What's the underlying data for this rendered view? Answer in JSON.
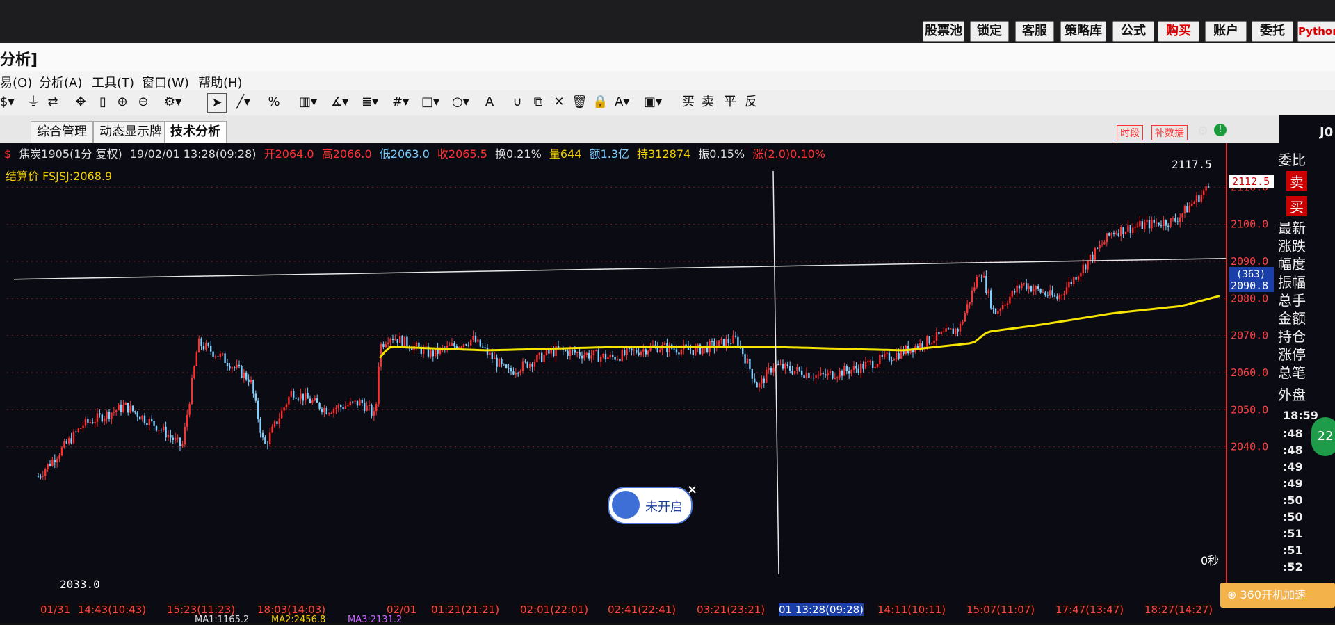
{
  "topbar": {
    "buttons": [
      "股票池",
      "锁定",
      "客服",
      "策略库",
      "公式",
      "购买",
      "账户",
      "委托",
      "Python"
    ]
  },
  "title": "分析]",
  "menu": [
    "易(O)",
    "分析(A)",
    "工具(T)",
    "窗口(W)",
    "帮助(H)"
  ],
  "toolbar": {
    "trade_labels": [
      "买",
      "卖",
      "平",
      "反"
    ],
    "text_tools": [
      "%",
      "A"
    ]
  },
  "tabs": [
    "综合管理",
    "动态显示牌",
    "技术分析"
  ],
  "chart_header": {
    "symbol": "焦炭1905(1分 复权)",
    "datetime": "19/02/01 13:28(09:28)",
    "open": "开2064.0",
    "high": "高2066.0",
    "low": "低2063.0",
    "close": "收2065.5",
    "turnover": "换0.21%",
    "volume": "量644",
    "amount": "额1.3亿",
    "hold": "持312874",
    "amplitude": "振0.15%",
    "change": "涨(2.0)0.10%",
    "settle": "结算价 FSJSJ:2068.9",
    "btn_time": "时段",
    "btn_fill": "补数据"
  },
  "chart_data": {
    "type": "candlestick",
    "ylim": [
      2030,
      2120
    ],
    "yticks": [
      "2110.0",
      "2100.0",
      "2090.0",
      "2080.0",
      "2070.0",
      "2060.0",
      "2050.0",
      "2040.0"
    ],
    "max_label": "2117.5",
    "min_label": "2033.0",
    "current_price": "2112.5",
    "cursor_price": "2090.8",
    "cursor_tag": "(363)",
    "seconds_label": "0秒",
    "x_labels": [
      "01/31",
      "14:43(10:43)",
      "15:23(11:23)",
      "18:03(14:03)",
      "02/01",
      "01:21(21:21)",
      "02:01(22:01)",
      "02:41(22:41)",
      "03:21(23:21)",
      "01 13:28(09:28)",
      "14:11(10:11)",
      "15:07(11:07)",
      "17:47(13:47)",
      "18:27(14:27)"
    ],
    "ma_labels": [
      "MA1:1165.2",
      "MA2:2456.8",
      "MA3:2131.2"
    ],
    "colors": {
      "up": "#ff3030",
      "down": "#80d0ff",
      "ma": "#f5e400",
      "grid": "#7a2020"
    }
  },
  "right_panel": {
    "labels": [
      "委比",
      "卖",
      "买",
      "最新",
      "涨跌",
      "幅度",
      "振幅",
      "总手",
      "金额",
      "持仓",
      "涨停",
      "总笔",
      "外盘"
    ],
    "times": [
      "18:59",
      ":48",
      ":48",
      ":49",
      ":49",
      ":50",
      ":50",
      ":51",
      ":51",
      ":52"
    ],
    "code": "J0",
    "percent": "22"
  },
  "popup": {
    "label": "未开启",
    "close": "×"
  },
  "hint": "360开机加速"
}
